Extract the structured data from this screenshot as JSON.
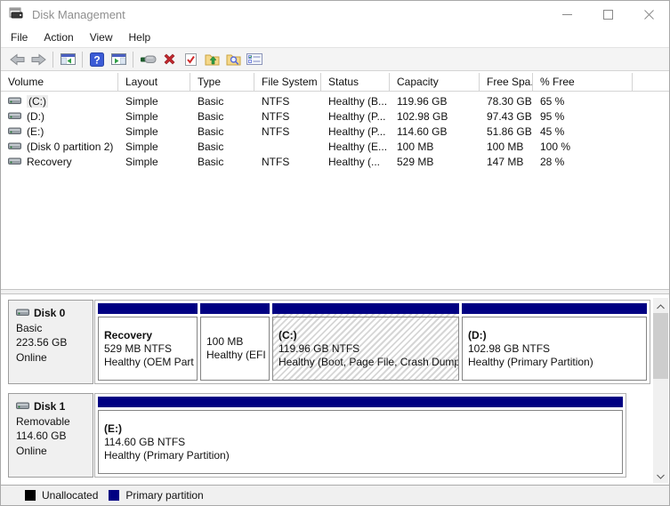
{
  "window": {
    "title": "Disk Management"
  },
  "menu": {
    "items": [
      {
        "label": "File"
      },
      {
        "label": "Action"
      },
      {
        "label": "View"
      },
      {
        "label": "Help"
      }
    ]
  },
  "toolbar": {
    "icon_names": [
      "back-icon",
      "forward-icon",
      "show-console-tree-icon",
      "help-icon",
      "show-action-pane-icon",
      "screwdriver-icon",
      "delete-icon",
      "document-check-icon",
      "folder-up-icon",
      "folder-magnifier-icon",
      "properties-list-icon"
    ]
  },
  "volume_table": {
    "columns": [
      {
        "label": "Volume"
      },
      {
        "label": "Layout"
      },
      {
        "label": "Type"
      },
      {
        "label": "File System"
      },
      {
        "label": "Status"
      },
      {
        "label": "Capacity"
      },
      {
        "label": "Free Spa..."
      },
      {
        "label": "% Free"
      }
    ],
    "rows": [
      {
        "volume": "(C:)",
        "layout": "Simple",
        "type": "Basic",
        "file_system": "NTFS",
        "status": "Healthy (B...",
        "capacity": "119.96 GB",
        "free_space": "78.30 GB",
        "pct_free": "65 %"
      },
      {
        "volume": "(D:)",
        "layout": "Simple",
        "type": "Basic",
        "file_system": "NTFS",
        "status": "Healthy (P...",
        "capacity": "102.98 GB",
        "free_space": "97.43 GB",
        "pct_free": "95 %"
      },
      {
        "volume": "(E:)",
        "layout": "Simple",
        "type": "Basic",
        "file_system": "NTFS",
        "status": "Healthy (P...",
        "capacity": "114.60 GB",
        "free_space": "51.86 GB",
        "pct_free": "45 %"
      },
      {
        "volume": "(Disk 0 partition 2)",
        "layout": "Simple",
        "type": "Basic",
        "file_system": "",
        "status": "Healthy (E...",
        "capacity": "100 MB",
        "free_space": "100 MB",
        "pct_free": "100 %"
      },
      {
        "volume": "Recovery",
        "layout": "Simple",
        "type": "Basic",
        "file_system": "NTFS",
        "status": "Healthy (...",
        "capacity": "529 MB",
        "free_space": "147 MB",
        "pct_free": "28 %"
      }
    ]
  },
  "disks": [
    {
      "name": "Disk 0",
      "media": "Basic",
      "size": "223.56 GB",
      "status": "Online",
      "partitions": [
        {
          "title": "Recovery",
          "size_line": "529 MB NTFS",
          "status_line": "Healthy (OEM Part"
        },
        {
          "title": "",
          "size_line": "100 MB",
          "status_line": "Healthy (EFI S"
        },
        {
          "title": "(C:)",
          "size_line": "119.96 GB NTFS",
          "status_line": "Healthy (Boot, Page File, Crash Dump"
        },
        {
          "title": "(D:)",
          "size_line": "102.98 GB NTFS",
          "status_line": "Healthy (Primary Partition)"
        }
      ]
    },
    {
      "name": "Disk 1",
      "media": "Removable",
      "size": "114.60 GB",
      "status": "Online",
      "partitions": [
        {
          "title": "(E:)",
          "size_line": "114.60 GB NTFS",
          "status_line": "Healthy (Primary Partition)"
        }
      ]
    }
  ],
  "legend": {
    "items": [
      {
        "label": "Unallocated",
        "color": "#000000"
      },
      {
        "label": "Primary partition",
        "color": "#000082"
      }
    ]
  },
  "colors": {
    "primary_partition": "#000082"
  }
}
